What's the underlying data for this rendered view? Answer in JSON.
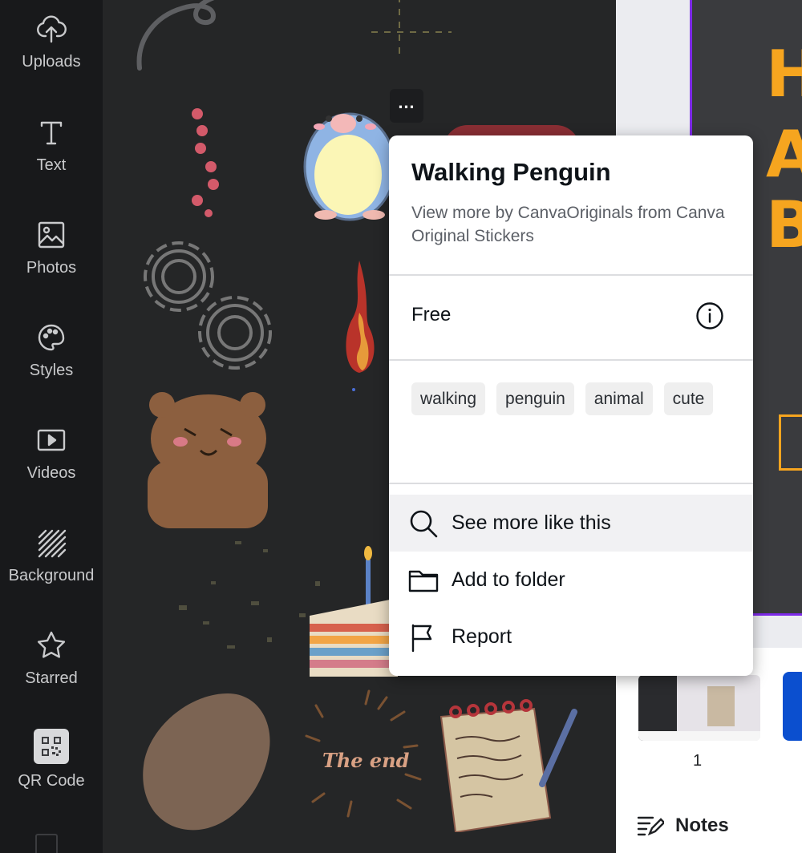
{
  "sidebar": {
    "items": [
      {
        "label": "Uploads",
        "icon": "cloud-upload-icon"
      },
      {
        "label": "Text",
        "icon": "text-icon"
      },
      {
        "label": "Photos",
        "icon": "image-icon"
      },
      {
        "label": "Styles",
        "icon": "palette-icon"
      },
      {
        "label": "Videos",
        "icon": "video-icon"
      },
      {
        "label": "Background",
        "icon": "hatch-pattern-icon"
      },
      {
        "label": "Starred",
        "icon": "star-icon"
      },
      {
        "label": "QR Code",
        "icon": "qr-code-icon"
      }
    ]
  },
  "stickers": {
    "decorative_text": "The end"
  },
  "popup": {
    "title": "Walking Penguin",
    "subtitle": "View more by CanvaOriginals from Canva Original Stickers",
    "price": "Free",
    "tags": [
      "walking",
      "penguin",
      "animal",
      "cute"
    ],
    "menu": [
      {
        "label": "See more like this",
        "icon": "search-icon"
      },
      {
        "label": "Add to folder",
        "icon": "folder-icon"
      },
      {
        "label": "Report",
        "icon": "flag-icon"
      }
    ]
  },
  "design_preview": {
    "letters": [
      "H",
      "A",
      "B"
    ],
    "accent_color": "#f6a51f",
    "selection_color": "#7d2ae8"
  },
  "pages": {
    "current_page_number": "1",
    "notes_label": "Notes"
  }
}
